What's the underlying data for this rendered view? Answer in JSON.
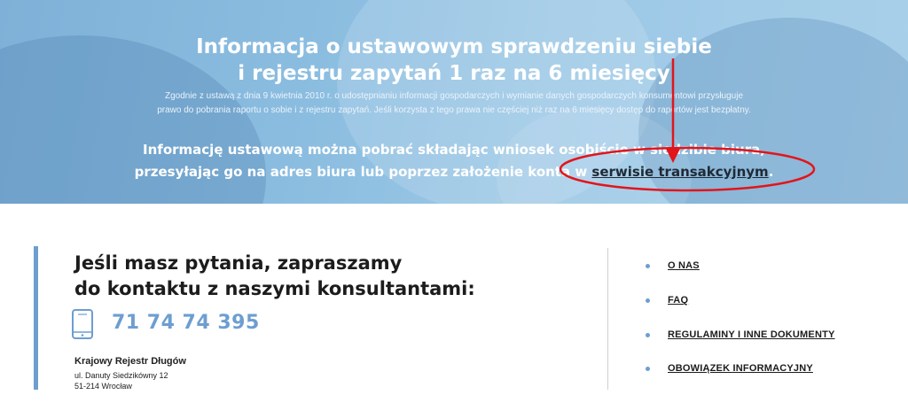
{
  "hero": {
    "title_line1": "Informacja o ustawowym sprawdzeniu siebie",
    "title_line2": "i rejestru zapytań 1 raz na 6 miesięcy",
    "desc_line1": "Zgodnie z ustawą z dnia 9 kwietnia 2010 r. o udostępnianiu informacji gospodarczych i wymianie danych gospodarczych konsumentowi przysługuje",
    "desc_line2": "prawo do pobrania raportu o sobie i z rejestru zapytań. Jeśli korzysta z tego prawa nie częściej niż raz na 6 miesięcy dostęp do raportów jest bezpłatny.",
    "info_line1": "Informację ustawową można pobrać składając wniosek osobiście w siedzibie biura,",
    "info_line2_prefix": "przesyłając go na adres biura lub poprzez założenie konta w",
    "info_link": "serwisie transakcyjnym",
    "info_suffix": "."
  },
  "contact": {
    "heading_line1": "Jeśli masz pytania, zapraszamy",
    "heading_line2": "do kontaktu z naszymi konsultantami:",
    "phone": "71 74 74 395",
    "company": "Krajowy Rejestr Długów",
    "address_line1": "ul. Danuty Siedzikówny 12",
    "address_line2": "51-214 Wrocław"
  },
  "nav": {
    "items": [
      {
        "label": "O NAS"
      },
      {
        "label": "FAQ"
      },
      {
        "label": "REGULAMINY I INNE DOKUMENTY"
      },
      {
        "label": "OBOWIĄZEK INFORMACYJNY"
      }
    ]
  },
  "colors": {
    "accent": "#6d9ed0",
    "annotation": "#e2151b",
    "hero_bg": "#8bbde0"
  },
  "icons": {
    "phone": "smartphone-icon",
    "bullet": "bullet-dot-icon"
  }
}
